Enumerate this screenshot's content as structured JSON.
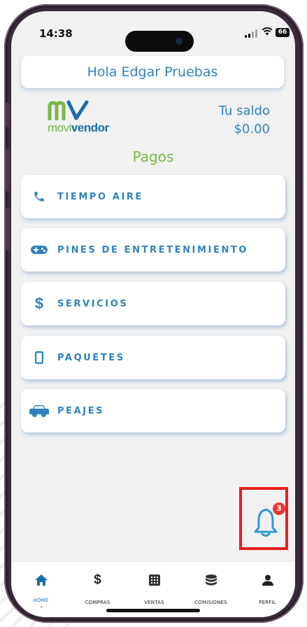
{
  "status_bar": {
    "time": "14:38",
    "battery": "66"
  },
  "header": {
    "greeting": "Hola Edgar Pruebas"
  },
  "brand": {
    "logo_prefix": "movi",
    "logo_suffix": "vendor",
    "green": "#7ab648",
    "blue": "#1e6da9"
  },
  "balance": {
    "label": "Tu saldo",
    "amount": "$0.00"
  },
  "section": {
    "title": "Pagos"
  },
  "menu": {
    "items": [
      {
        "label": "TIEMPO AIRE",
        "icon": "phone-icon"
      },
      {
        "label": "PINES DE ENTRETENIMIENTO",
        "icon": "gamepad-icon"
      },
      {
        "label": "SERVICIOS",
        "icon": "dollar-icon"
      },
      {
        "label": "PAQUETES",
        "icon": "mobile-icon"
      },
      {
        "label": "PEAJES",
        "icon": "car-icon"
      }
    ]
  },
  "notifications": {
    "count": "3",
    "icon": "bell-icon"
  },
  "tabbar": {
    "tabs": [
      {
        "label": "HOME",
        "icon": "home-icon",
        "active": true
      },
      {
        "label": "COMPRAS",
        "icon": "dollar-icon"
      },
      {
        "label": "VENTAS",
        "icon": "grid-icon"
      },
      {
        "label": "COMISIONES",
        "icon": "coins-icon"
      },
      {
        "label": "PERFIL",
        "icon": "user-icon"
      }
    ]
  },
  "colors": {
    "accent": "#2f82be",
    "highlight": "#e81f1f",
    "badge": "#e53935"
  }
}
